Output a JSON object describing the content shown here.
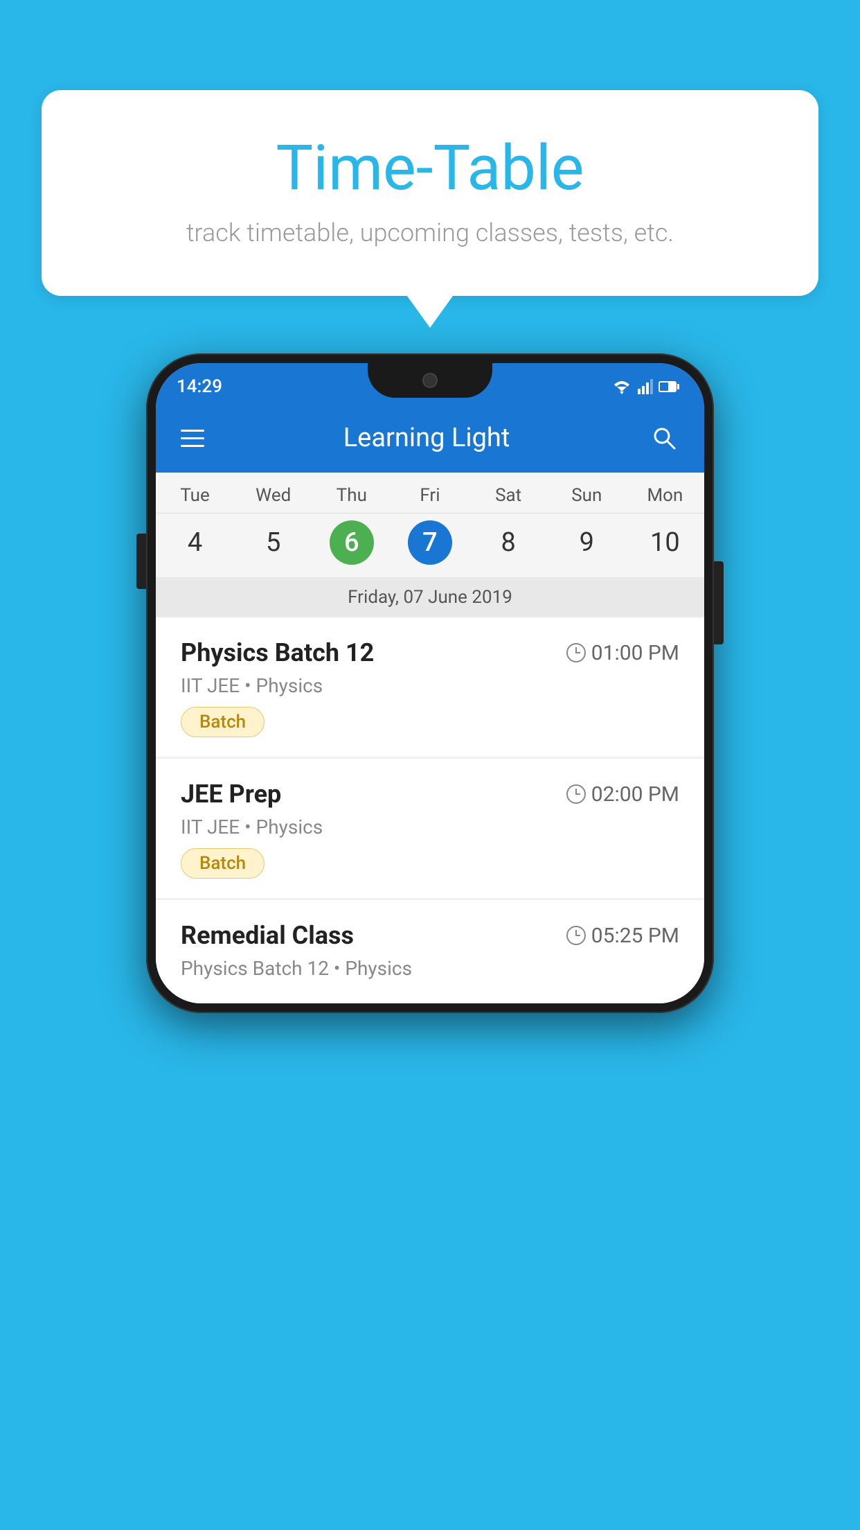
{
  "background_color": "#29b6e8",
  "speech_bubble": {
    "title": "Time-Table",
    "subtitle": "track timetable, upcoming classes, tests, etc."
  },
  "phone": {
    "status_bar": {
      "time": "14:29"
    },
    "app_bar": {
      "title": "Learning Light"
    },
    "calendar": {
      "days": [
        {
          "label": "Tue",
          "number": "4"
        },
        {
          "label": "Wed",
          "number": "5"
        },
        {
          "label": "Thu",
          "number": "6",
          "style": "green"
        },
        {
          "label": "Fri",
          "number": "7",
          "style": "blue"
        },
        {
          "label": "Sat",
          "number": "8"
        },
        {
          "label": "Sun",
          "number": "9"
        },
        {
          "label": "Mon",
          "number": "10"
        }
      ],
      "selected_date": "Friday, 07 June 2019"
    },
    "schedule_items": [
      {
        "title": "Physics Batch 12",
        "time": "01:00 PM",
        "subtitle": "IIT JEE • Physics",
        "tag": "Batch"
      },
      {
        "title": "JEE Prep",
        "time": "02:00 PM",
        "subtitle": "IIT JEE • Physics",
        "tag": "Batch"
      },
      {
        "title": "Remedial Class",
        "time": "05:25 PM",
        "subtitle": "Physics Batch 12 • Physics",
        "tag": null
      }
    ]
  }
}
